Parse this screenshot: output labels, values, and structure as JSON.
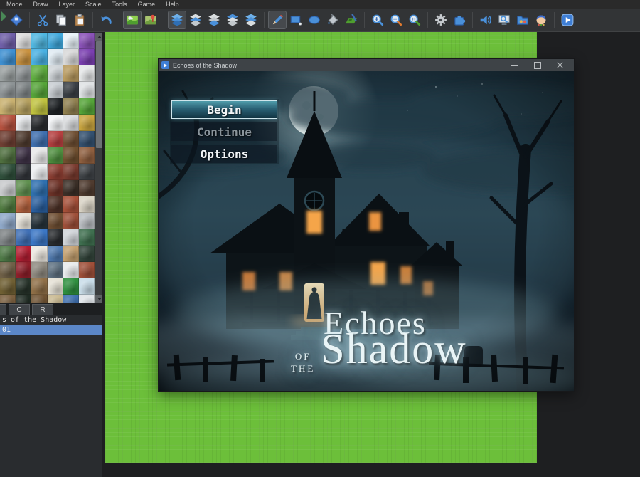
{
  "menubar": {
    "items": [
      "Mode",
      "Draw",
      "Layer",
      "Scale",
      "Tools",
      "Game",
      "Help"
    ]
  },
  "toolbar": {
    "icons": [
      "save",
      "cut",
      "copy",
      "paste",
      "undo",
      "map-edit-mode",
      "event-edit-mode",
      "layer-auto",
      "layer-1",
      "layer-2",
      "layer-3",
      "layer-4",
      "pencil-tool",
      "rectangle-tool",
      "ellipse-tool",
      "fill-tool",
      "shadow-pen-tool",
      "zoom-in",
      "zoom-out",
      "zoom-actual-size",
      "database",
      "plugin-manager",
      "sound-test",
      "event-searcher",
      "resource-manager",
      "character-generator",
      "playtest"
    ]
  },
  "tileset": {
    "tabs": [
      "C",
      "R"
    ],
    "rows": [
      [
        "#6f5fa8",
        "#dcdcdc",
        "#4fb6e0",
        "#3fa8dc",
        "#e8f2f8",
        "#8a52b8"
      ],
      [
        "#3e8fd0",
        "#c8913f",
        "#49b0e2",
        "#dfeaf2",
        "#d8d8d8",
        "#7a3fb0"
      ],
      [
        "#9aa0a0",
        "#8f9496",
        "#5fae3f",
        "#cfd4d8",
        "#b89a5f",
        "#e5e7e8"
      ],
      [
        "#8c9294",
        "#7f8587",
        "#55a438",
        "#c8cdd2",
        "#3a3f45",
        "#dfe2e4"
      ],
      [
        "#c8b06f",
        "#b5a05f",
        "#bfc23f",
        "#1f2326",
        "#8f7f4f",
        "#55a438"
      ],
      [
        "#b5523f",
        "#e8eaec",
        "#2a2d30",
        "#f2f4f6",
        "#d8dadc",
        "#c8a43f"
      ],
      [
        "#6f3f33",
        "#4f3b2f",
        "#3f6fae",
        "#b53f3f",
        "#6f4f33",
        "#33506f"
      ],
      [
        "#4f6f3f",
        "#3f3347",
        "#e8e8e8",
        "#4f8f3f",
        "#6f4f2f",
        "#8f5f3f"
      ],
      [
        "#2f4f3b",
        "#33363b",
        "#eceef0",
        "#8f3f33",
        "#7a3b2f",
        "#3f4347"
      ],
      [
        "#c8cacc",
        "#5f8f4f",
        "#2f6fae",
        "#6f3328",
        "#3b2f27",
        "#4f3b2f"
      ],
      [
        "#4f7a3f",
        "#b5633f",
        "#2a5f9e",
        "#4f3328",
        "#a65039",
        "#d8d2c4"
      ],
      [
        "#8fa8c8",
        "#e8e4da",
        "#27333b",
        "#6f4f33",
        "#9e4f39",
        "#b8bcc0"
      ],
      [
        "#7f8486",
        "#3f6fb5",
        "#3b76c4",
        "#2a2d30",
        "#d0d4d8",
        "#3f6f4f"
      ],
      [
        "#4f7a47",
        "#b51f33",
        "#ece8e0",
        "#4f7ab0",
        "#c4a06f",
        "#33453b"
      ],
      [
        "#6f6047",
        "#8f1f2a",
        "#8f8a80",
        "#5f7282",
        "#e8eaec",
        "#9e4f39"
      ],
      [
        "#6f5f33",
        "#27332a",
        "#8f6f47",
        "#e4e0d4",
        "#2f8f3f",
        "#c8dce8"
      ],
      [
        "#7a5f3f",
        "#1f2b23",
        "#6f5333",
        "#c8b88f",
        "#3f6fae",
        "#dfe4e8"
      ]
    ]
  },
  "map_list": {
    "header": "s of the Shadow",
    "items": [
      {
        "label": "01",
        "selected": true
      }
    ]
  },
  "game_window": {
    "title": "Echoes of the Shadow",
    "controls": [
      "minimize",
      "maximize",
      "close"
    ],
    "menu": {
      "items": [
        {
          "label": "Begin",
          "state": "selected"
        },
        {
          "label": "Continue",
          "state": "disabled"
        },
        {
          "label": "Options",
          "state": "normal"
        }
      ]
    },
    "logo": {
      "line1": "Echoes",
      "of": "OF",
      "the": "THE",
      "line2": "Shadow"
    }
  },
  "colors": {
    "map_green": "#6cbf3a",
    "selection_blue": "#5b87c8",
    "menu_highlight_teal": "#3f8fa5",
    "window_titlebar": "#3e4347",
    "warm_window_glow": "#f5a54a"
  }
}
